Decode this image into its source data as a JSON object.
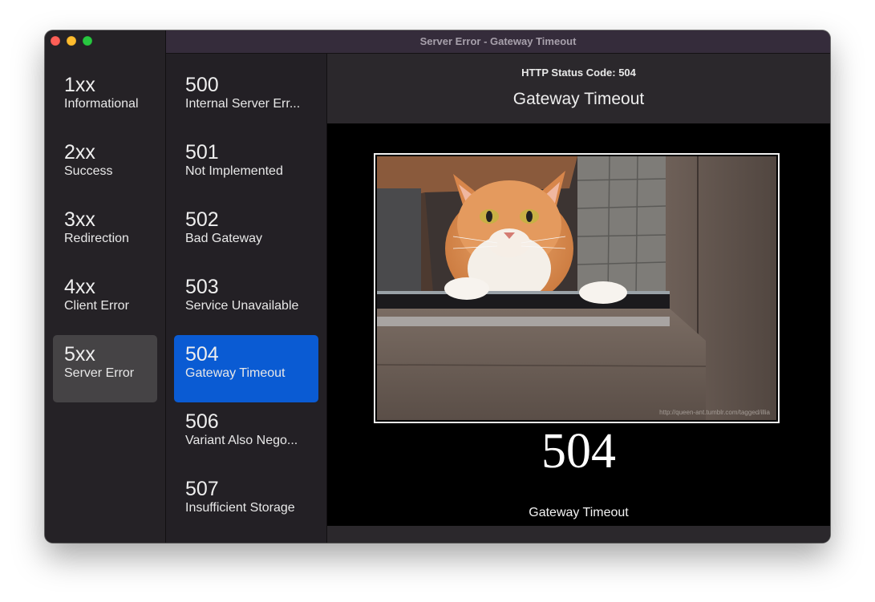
{
  "window": {
    "title": "Server Error - Gateway Timeout"
  },
  "categories": [
    {
      "code": "1xx",
      "name": "Informational"
    },
    {
      "code": "2xx",
      "name": "Success"
    },
    {
      "code": "3xx",
      "name": "Redirection"
    },
    {
      "code": "4xx",
      "name": "Client Error"
    },
    {
      "code": "5xx",
      "name": "Server Error",
      "selected": true
    }
  ],
  "codes": [
    {
      "code": "500",
      "name": "Internal Server Err..."
    },
    {
      "code": "501",
      "name": "Not Implemented"
    },
    {
      "code": "502",
      "name": "Bad Gateway"
    },
    {
      "code": "503",
      "name": "Service Unavailable"
    },
    {
      "code": "504",
      "name": "Gateway Timeout",
      "selected": true
    },
    {
      "code": "506",
      "name": "Variant Also Nego..."
    },
    {
      "code": "507",
      "name": "Insufficient Storage"
    }
  ],
  "detail": {
    "status_line": "HTTP Status Code: 504",
    "title": "Gateway Timeout",
    "poster_code": "504",
    "poster_caption": "Gateway Timeout",
    "watermark": "http://queen-ant.tumblr.com/tagged/illia"
  },
  "colors": {
    "selection_blue": "#0a5bd3",
    "category_selected": "#454345",
    "titlebar": "#352c3b"
  },
  "icons": {
    "close": "traffic-light-close-icon",
    "minimize": "traffic-light-minimize-icon",
    "zoom": "traffic-light-zoom-icon"
  }
}
